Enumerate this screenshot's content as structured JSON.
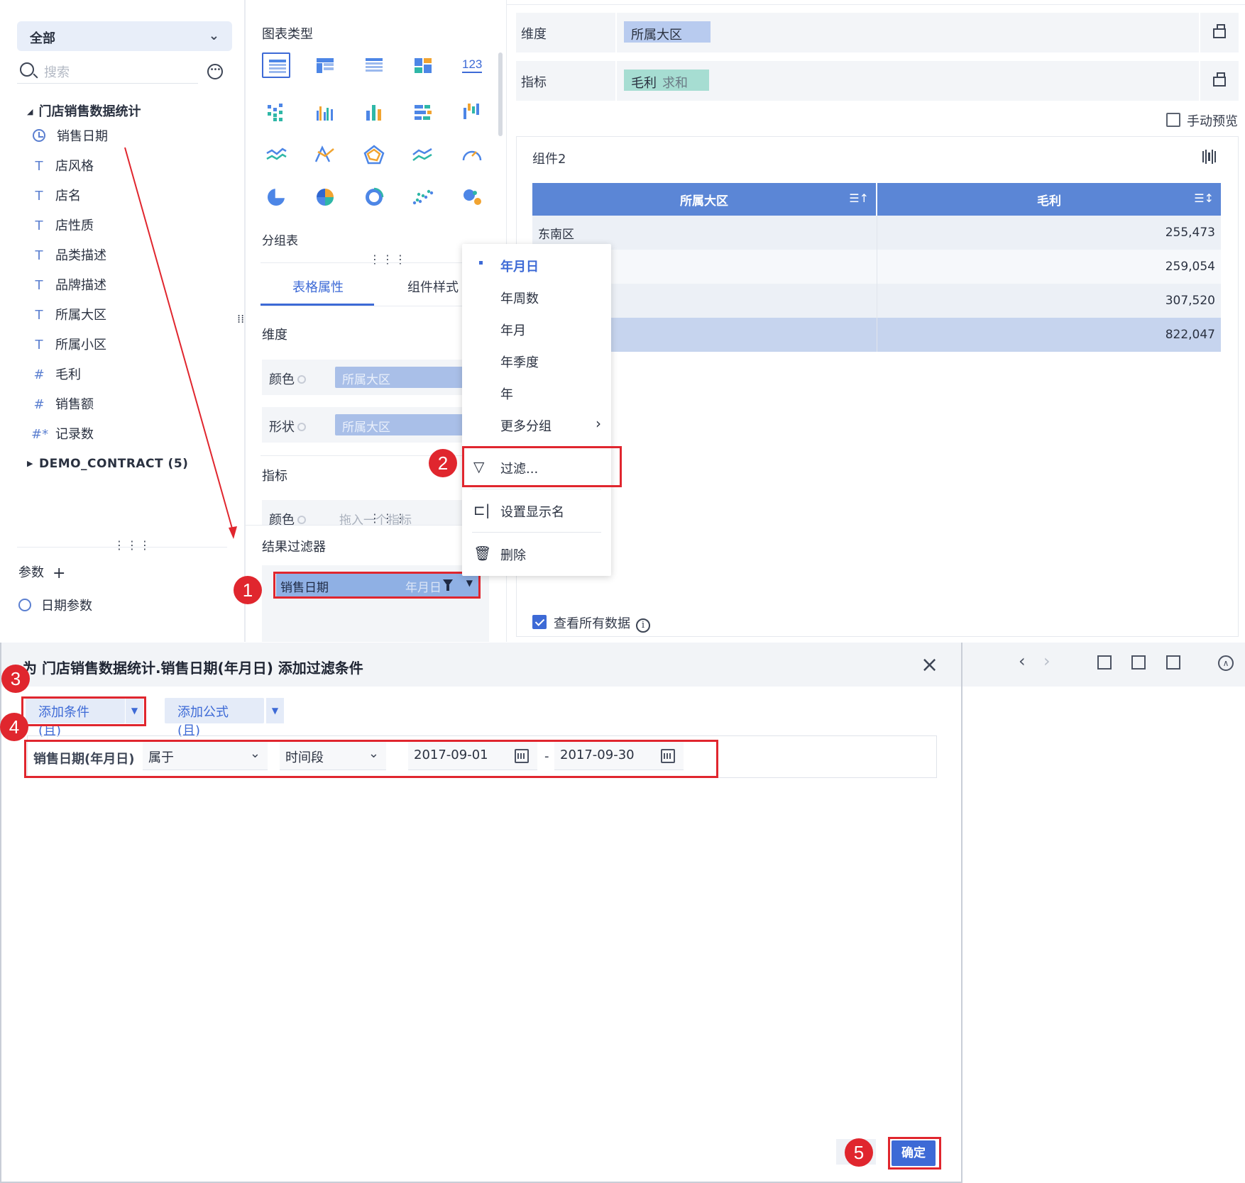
{
  "left": {
    "scope_select": "全部",
    "search_placeholder": "搜索",
    "dataset": "门店销售数据统计",
    "fields": [
      {
        "icon": "clock-icon",
        "label": "销售日期"
      },
      {
        "icon": "text-type-icon",
        "label": "店风格"
      },
      {
        "icon": "text-type-icon",
        "label": "店名"
      },
      {
        "icon": "text-type-icon",
        "label": "店性质"
      },
      {
        "icon": "text-type-icon",
        "label": "品类描述"
      },
      {
        "icon": "text-type-icon",
        "label": "品牌描述"
      },
      {
        "icon": "text-type-icon",
        "label": "所属大区"
      },
      {
        "icon": "text-type-icon",
        "label": "所属小区"
      },
      {
        "icon": "number-type-icon",
        "label": "毛利"
      },
      {
        "icon": "number-type-icon",
        "label": "销售额"
      },
      {
        "icon": "count-type-icon",
        "label": "记录数"
      }
    ],
    "other_dataset": "DEMO_CONTRACT (5)",
    "params_label": "参数",
    "date_param": "日期参数"
  },
  "middle": {
    "chart_type_label": "图表类型",
    "number_icon_text": "123",
    "group_table_label": "分组表",
    "tabs": [
      "表格属性",
      "组件样式"
    ],
    "dimension_label": "维度",
    "color_label": "颜色",
    "shape_label": "形状",
    "color_dim_value": "所属大区",
    "shape_dim_value": "所属大区",
    "metric_label": "指标",
    "metric_color_label": "颜色",
    "metric_drop_placeholder": "拖入一个指标",
    "result_filter_label": "结果过滤器",
    "filter_chip": {
      "field": "销售日期",
      "granularity": "年月日"
    }
  },
  "context_menu": {
    "items": [
      "年月日",
      "年周数",
      "年月",
      "年季度",
      "年"
    ],
    "more": "更多分组",
    "filter": "过滤...",
    "rename": "设置显示名",
    "delete": "删除"
  },
  "right": {
    "dimension_label": "维度",
    "dimension_chip": "所属大区",
    "metric_label": "指标",
    "metric_chip": "毛利",
    "metric_agg": "求和",
    "manual_preview": "手动预览",
    "component_title": "组件2",
    "table_headers": [
      "所属大区",
      "毛利"
    ],
    "rows": [
      [
        "东南区",
        "255,473"
      ],
      [
        "",
        "259,054"
      ],
      [
        "",
        "307,520"
      ],
      [
        "",
        "822,047"
      ]
    ],
    "view_all": "查看所有数据"
  },
  "dialog": {
    "title": "为 门店销售数据统计.销售日期(年月日) 添加过滤条件",
    "add_condition": "添加条件(且)",
    "add_formula": "添加公式(且)",
    "condition": {
      "field": "销售日期(年月日)",
      "operator": "属于",
      "mode": "时间段",
      "start": "2017-09-01",
      "separator": "-",
      "end": "2017-09-30"
    },
    "confirm": "确定"
  },
  "annotations": [
    "1",
    "2",
    "3",
    "4",
    "5"
  ],
  "colors": {
    "accent": "#3d6ad6",
    "highlight": "#e0262e",
    "header": "#5b86d6"
  }
}
